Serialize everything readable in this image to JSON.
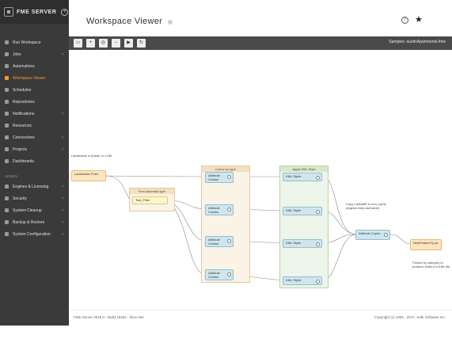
{
  "brand": {
    "name": "FME SERVER"
  },
  "sidebar": {
    "items": [
      {
        "label": "Run Workspace",
        "chevron": false,
        "active": false
      },
      {
        "label": "Jobs",
        "chevron": true,
        "active": false
      },
      {
        "label": "Automations",
        "chevron": false,
        "active": false
      },
      {
        "label": "Workspace Viewer",
        "chevron": false,
        "active": true
      },
      {
        "label": "Schedules",
        "chevron": false,
        "active": false
      },
      {
        "label": "Repositories",
        "chevron": false,
        "active": false
      },
      {
        "label": "Notifications",
        "chevron": true,
        "active": false
      },
      {
        "label": "Resources",
        "chevron": false,
        "active": false
      },
      {
        "label": "Connections",
        "chevron": true,
        "active": false
      },
      {
        "label": "Projects",
        "chevron": true,
        "active": false
      },
      {
        "label": "Dashboards",
        "chevron": false,
        "active": false
      }
    ],
    "admin_label": "ADMIN",
    "admin_items": [
      {
        "label": "Engines & Licensing",
        "chevron": true
      },
      {
        "label": "Security",
        "chevron": true
      },
      {
        "label": "System Cleanup",
        "chevron": true
      },
      {
        "label": "Backup & Restore",
        "chevron": true
      },
      {
        "label": "System Configuration",
        "chevron": true
      }
    ]
  },
  "header": {
    "title": "Workspace Viewer"
  },
  "toolbar": {
    "workspace_file": "Samples: austinApartments.fmw"
  },
  "canvas": {
    "notes": {
      "n1": "Landmarks in Austin, in LUM",
      "n2": "Copy LANAME to kml_name (legend entry and label)",
      "n3": "Fanout by category to produce folders in KML file"
    },
    "bookmarks": {
      "b1": "Find landmark type",
      "b2": "Colour by type",
      "b3": "Apply KML Style"
    },
    "transformers": {
      "reader": "Landmarks Point",
      "tester": "Test_Filter",
      "ac1": "Attribute Creator",
      "ac2": "Attribute Creator",
      "ac3": "Attribute Creator",
      "ac4": "Attribute Creator",
      "kml1": "KML Styler",
      "kml2": "KML Styler",
      "kml3": "KML Styler",
      "kml4": "KML Styler",
      "copier": "Attribute Copier",
      "writer": "NewFeatureTy pe"
    }
  },
  "footer": {
    "version": "FME Server 2018.0 - Build 18264 - linux-x64",
    "copyright": "Copyright (c) 1994 - 2017, Safe Software Inc."
  },
  "colors": {
    "accent": "#f29b38",
    "sidebar_bg": "#3a3a3a",
    "toolbar_bg": "#4a4a4a"
  }
}
